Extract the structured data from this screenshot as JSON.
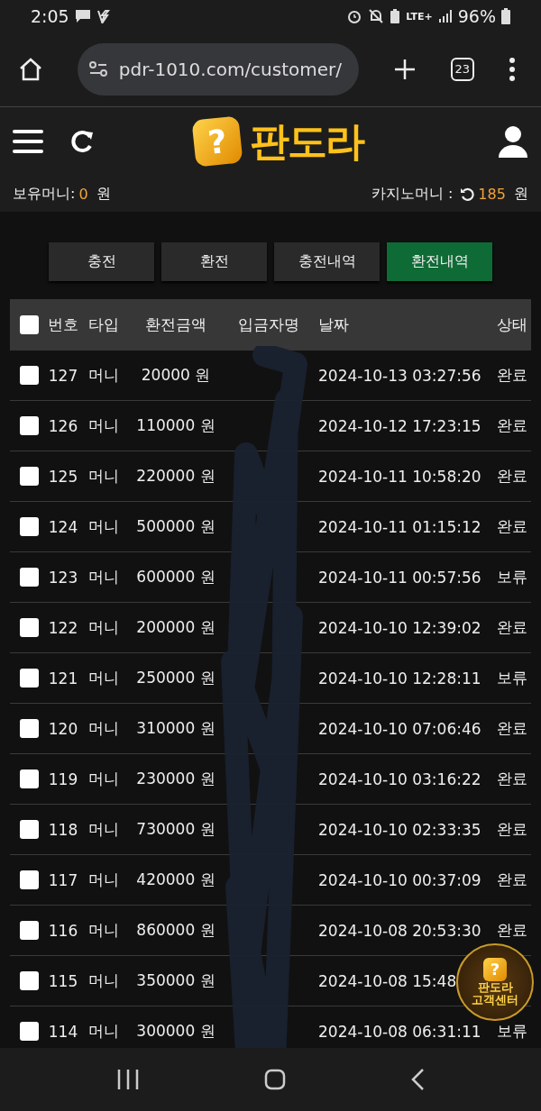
{
  "status_bar": {
    "time": "2:05",
    "network": "LTE+",
    "battery": "96%"
  },
  "browser": {
    "url": "pdr-1010.com/customer/",
    "tab_count": "23"
  },
  "header": {
    "logo_mark": "?",
    "logo_text": "판도라"
  },
  "balances": [
    {
      "label": "보유머니:",
      "value": "0",
      "unit": "원"
    },
    {
      "label": "카지노머니 :",
      "value": "185",
      "unit": "원"
    }
  ],
  "tabs": [
    {
      "label": "충전",
      "selected": false
    },
    {
      "label": "환전",
      "selected": false
    },
    {
      "label": "충전내역",
      "selected": false
    },
    {
      "label": "환전내역",
      "selected": true
    }
  ],
  "table": {
    "header_checked": false,
    "columns": [
      "번호",
      "타입",
      "환전금액",
      "입금자명",
      "날짜",
      "상태"
    ],
    "rows": [
      {
        "no": "127",
        "type": "머니",
        "amount": "20000 원",
        "date": "2024-10-13 03:27:56",
        "status": "완료",
        "checked": false
      },
      {
        "no": "126",
        "type": "머니",
        "amount": "110000 원",
        "date": "2024-10-12 17:23:15",
        "status": "완료",
        "checked": false
      },
      {
        "no": "125",
        "type": "머니",
        "amount": "220000 원",
        "date": "2024-10-11 10:58:20",
        "status": "완료",
        "checked": false
      },
      {
        "no": "124",
        "type": "머니",
        "amount": "500000 원",
        "date": "2024-10-11 01:15:12",
        "status": "완료",
        "checked": false
      },
      {
        "no": "123",
        "type": "머니",
        "amount": "600000 원",
        "date": "2024-10-11 00:57:56",
        "status": "보류",
        "checked": false
      },
      {
        "no": "122",
        "type": "머니",
        "amount": "200000 원",
        "date": "2024-10-10 12:39:02",
        "status": "완료",
        "checked": false
      },
      {
        "no": "121",
        "type": "머니",
        "amount": "250000 원",
        "date": "2024-10-10 12:28:11",
        "status": "보류",
        "checked": false
      },
      {
        "no": "120",
        "type": "머니",
        "amount": "310000 원",
        "date": "2024-10-10 07:06:46",
        "status": "완료",
        "checked": false
      },
      {
        "no": "119",
        "type": "머니",
        "amount": "230000 원",
        "date": "2024-10-10 03:16:22",
        "status": "완료",
        "checked": false
      },
      {
        "no": "118",
        "type": "머니",
        "amount": "730000 원",
        "date": "2024-10-10 02:33:35",
        "status": "완료",
        "checked": false
      },
      {
        "no": "117",
        "type": "머니",
        "amount": "420000 원",
        "date": "2024-10-10 00:37:09",
        "status": "완료",
        "checked": false
      },
      {
        "no": "116",
        "type": "머니",
        "amount": "860000 원",
        "date": "2024-10-08 20:53:30",
        "status": "완료",
        "checked": false
      },
      {
        "no": "115",
        "type": "머니",
        "amount": "350000 원",
        "date": "2024-10-08 15:48",
        "checked": false
      },
      {
        "no": "114",
        "type": "머니",
        "amount": "300000 원",
        "date": "2024-10-08 06:31:11",
        "status": "보류",
        "checked": false
      }
    ]
  },
  "support_badge": {
    "mark": "?",
    "title": "판도라",
    "subtitle": "고객센터"
  }
}
